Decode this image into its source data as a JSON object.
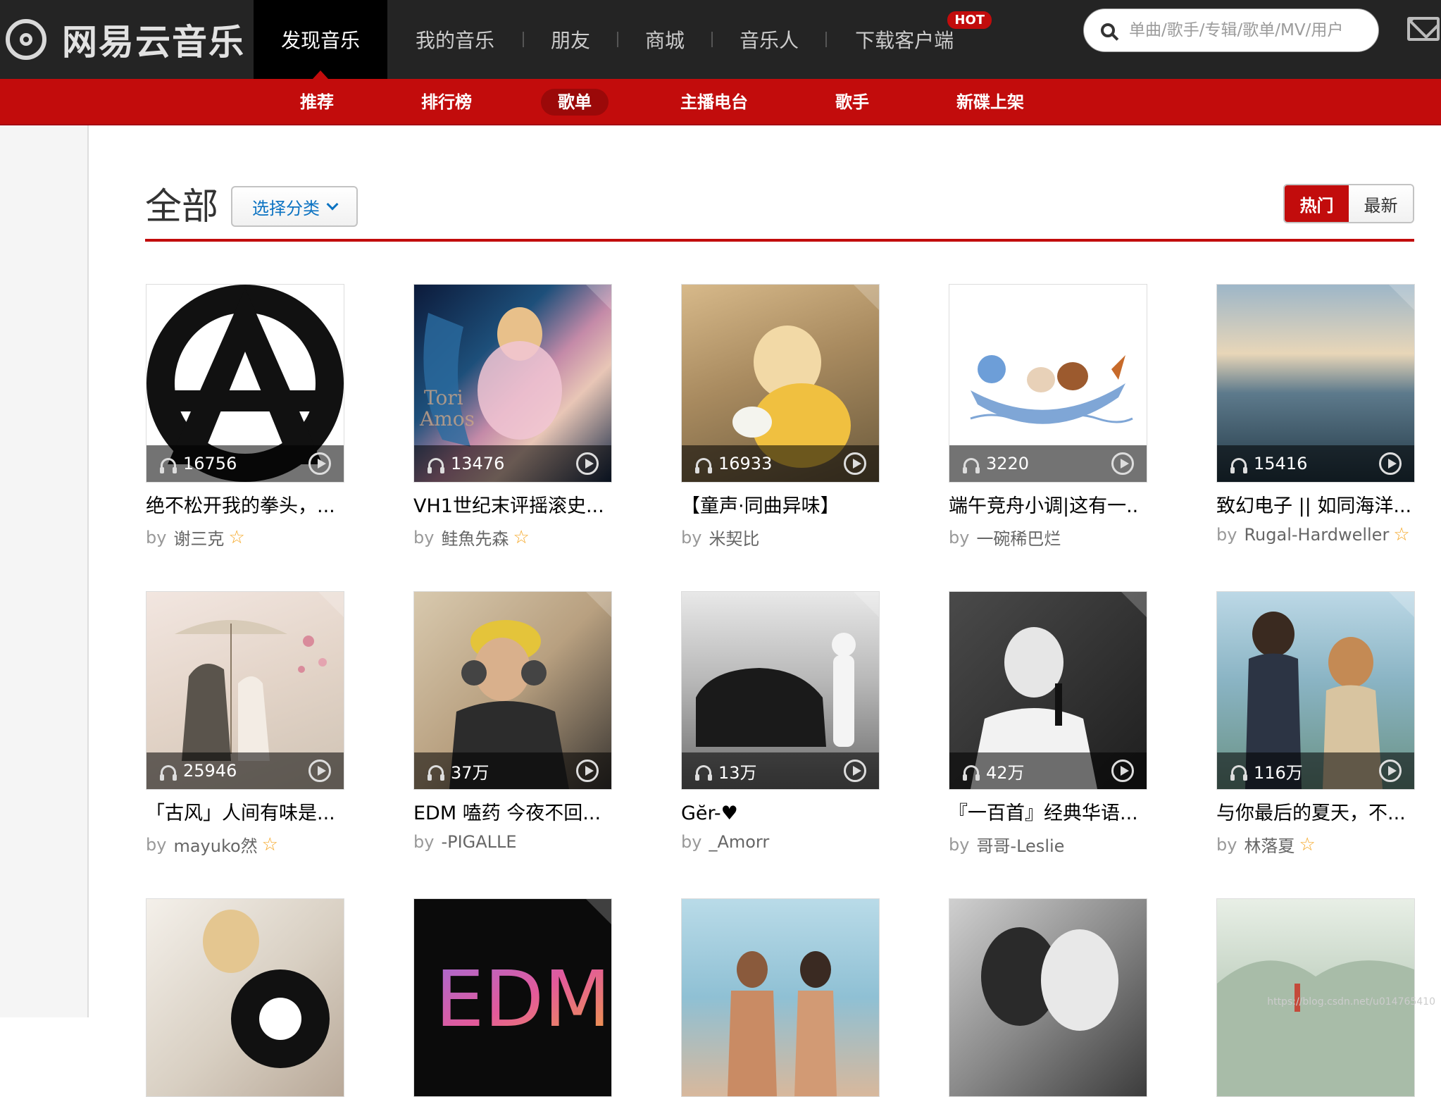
{
  "brand": {
    "name": "网易云音乐"
  },
  "nav": [
    {
      "label": "发现音乐",
      "active": true
    },
    {
      "label": "我的音乐"
    },
    {
      "label": "朋友"
    },
    {
      "label": "商城"
    },
    {
      "label": "音乐人"
    },
    {
      "label": "下载客户端",
      "badge": "HOT"
    }
  ],
  "search": {
    "placeholder": "单曲/歌手/专辑/歌单/MV/用户"
  },
  "subnav": [
    {
      "label": "推荐"
    },
    {
      "label": "排行榜"
    },
    {
      "label": "歌单",
      "active": true
    },
    {
      "label": "主播电台"
    },
    {
      "label": "歌手"
    },
    {
      "label": "新碟上架"
    }
  ],
  "header": {
    "title": "全部",
    "category_button": "选择分类",
    "sort": [
      "热门",
      "最新"
    ]
  },
  "by_prefix": "by",
  "playlists": [
    {
      "plays": "16756",
      "title": "绝不松开我的拳头，...",
      "creator": "谢三克",
      "star": true
    },
    {
      "plays": "13476",
      "title": "VH1世纪末评摇滚史...",
      "creator": "鲑魚先森",
      "star": true
    },
    {
      "plays": "16933",
      "title": "【童声·同曲异味】",
      "creator": "米契比",
      "star": false
    },
    {
      "plays": "3220",
      "title": "端午竞舟小调|这有一..",
      "creator": "一碗稀巴烂",
      "star": false
    },
    {
      "plays": "15416",
      "title": "致幻电子 || 如同海洋...",
      "creator": "Rugal-Hardweller",
      "star": true
    },
    {
      "plays": "25946",
      "title": "「古风」人间有味是...",
      "creator": "mayuko然",
      "star": true
    },
    {
      "plays": "37万",
      "title": "EDM 嗑药 今夜不回...",
      "creator": "-PIGALLE",
      "star": false
    },
    {
      "plays": "13万",
      "title": "Gĕr-♥",
      "creator": "_Amorr",
      "star": false
    },
    {
      "plays": "42万",
      "title": "『一百首』经典华语...",
      "creator": "哥哥-Leslie",
      "star": false
    },
    {
      "plays": "116万",
      "title": "与你最后的夏天，不...",
      "creator": "林落夏",
      "star": true
    },
    {
      "plays": "",
      "title": "",
      "creator": "",
      "star": false
    },
    {
      "plays": "",
      "title": "",
      "creator": "",
      "star": false
    },
    {
      "plays": "",
      "title": "",
      "creator": "",
      "star": false
    },
    {
      "plays": "",
      "title": "",
      "creator": "",
      "star": false
    },
    {
      "plays": "",
      "title": "",
      "creator": "",
      "star": false
    }
  ],
  "watermark": "https://blog.csdn.net/u014765410"
}
